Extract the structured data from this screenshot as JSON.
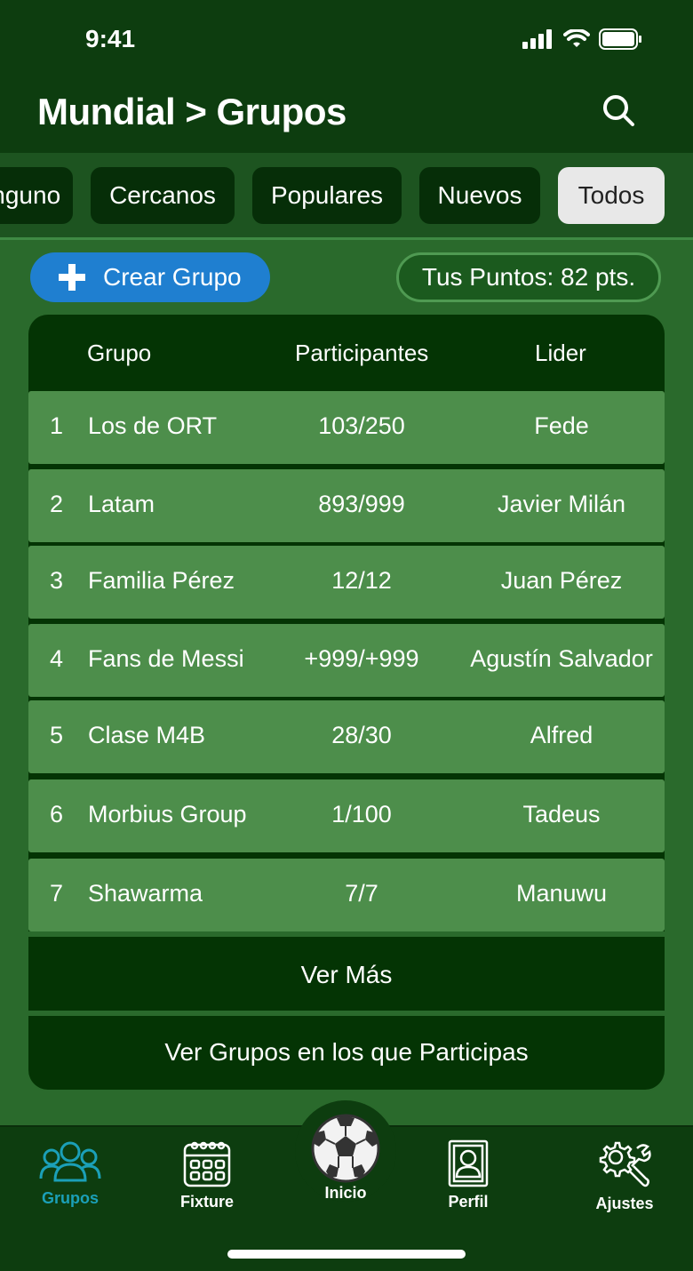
{
  "status": {
    "time": "9:41"
  },
  "header": {
    "title": "Mundial > Grupos"
  },
  "tabs": [
    "Ninguno",
    "Cercanos",
    "Populares",
    "Nuevos",
    "Todos"
  ],
  "active_tab": "Todos",
  "actions": {
    "create_label": "Crear Grupo",
    "points_label": "Tus Puntos: 82 pts."
  },
  "table": {
    "headers": {
      "group": "Grupo",
      "participants": "Participantes",
      "leader": "Lider"
    },
    "rows": [
      {
        "rank": "1",
        "name": "Los de ORT",
        "participants": "103/250",
        "leader": "Fede"
      },
      {
        "rank": "2",
        "name": "Latam",
        "participants": "893/999",
        "leader": "Javier Milán"
      },
      {
        "rank": "3",
        "name": "Familia Pérez",
        "participants": "12/12",
        "leader": "Juan Pérez"
      },
      {
        "rank": "4",
        "name": "Fans de Messi",
        "participants": "+999/+999",
        "leader": "Agustín Salvador"
      },
      {
        "rank": "5",
        "name": "Clase M4B",
        "participants": "28/30",
        "leader": "Alfred"
      },
      {
        "rank": "6",
        "name": "Morbius Group",
        "participants": "1/100",
        "leader": "Tadeus"
      },
      {
        "rank": "7",
        "name": "Shawarma",
        "participants": "7/7",
        "leader": "Manuwu"
      }
    ],
    "more_label": "Ver Más",
    "participating_label": "Ver Grupos en los que Participas"
  },
  "nav": {
    "groups": "Grupos",
    "fixture": "Fixture",
    "home": "Inicio",
    "profile": "Perfil",
    "settings": "Ajustes"
  },
  "colors": {
    "header_bg": "#0d3d0f",
    "body_bg": "#2a6a2c",
    "row_bg": "#4d8e4b",
    "accent_blue": "#1f7fd0",
    "nav_active": "#1ba0b8"
  }
}
